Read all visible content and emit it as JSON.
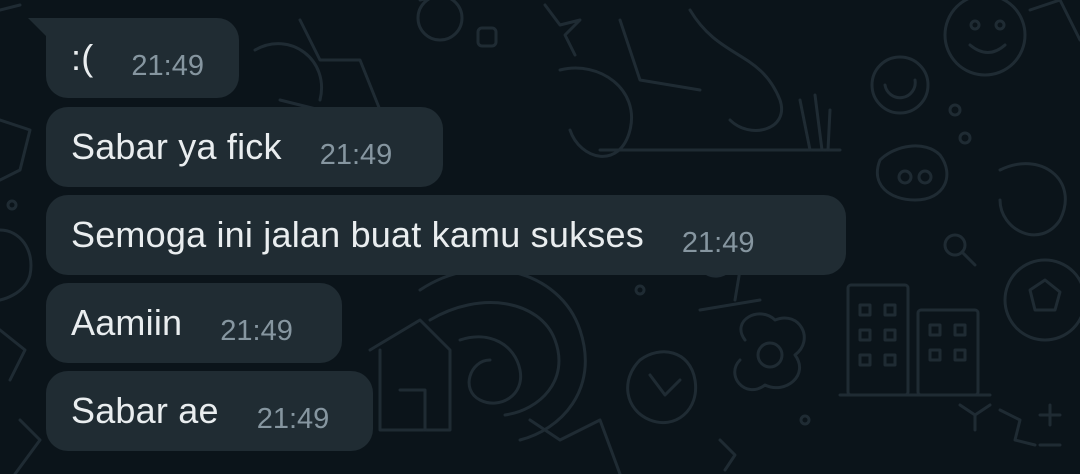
{
  "conversation": {
    "messages": [
      {
        "text": ":(",
        "time": "21:49"
      },
      {
        "text": "Sabar ya fick",
        "time": "21:49"
      },
      {
        "text": "Semoga ini jalan buat kamu sukses",
        "time": "21:49"
      },
      {
        "text": "Aamiin",
        "time": "21:49"
      },
      {
        "text": "Sabar ae",
        "time": "21:49"
      }
    ]
  },
  "colors": {
    "background": "#0b141a",
    "bubble": "#202c33",
    "text": "#e9edef",
    "timestamp": "#8696a0"
  }
}
